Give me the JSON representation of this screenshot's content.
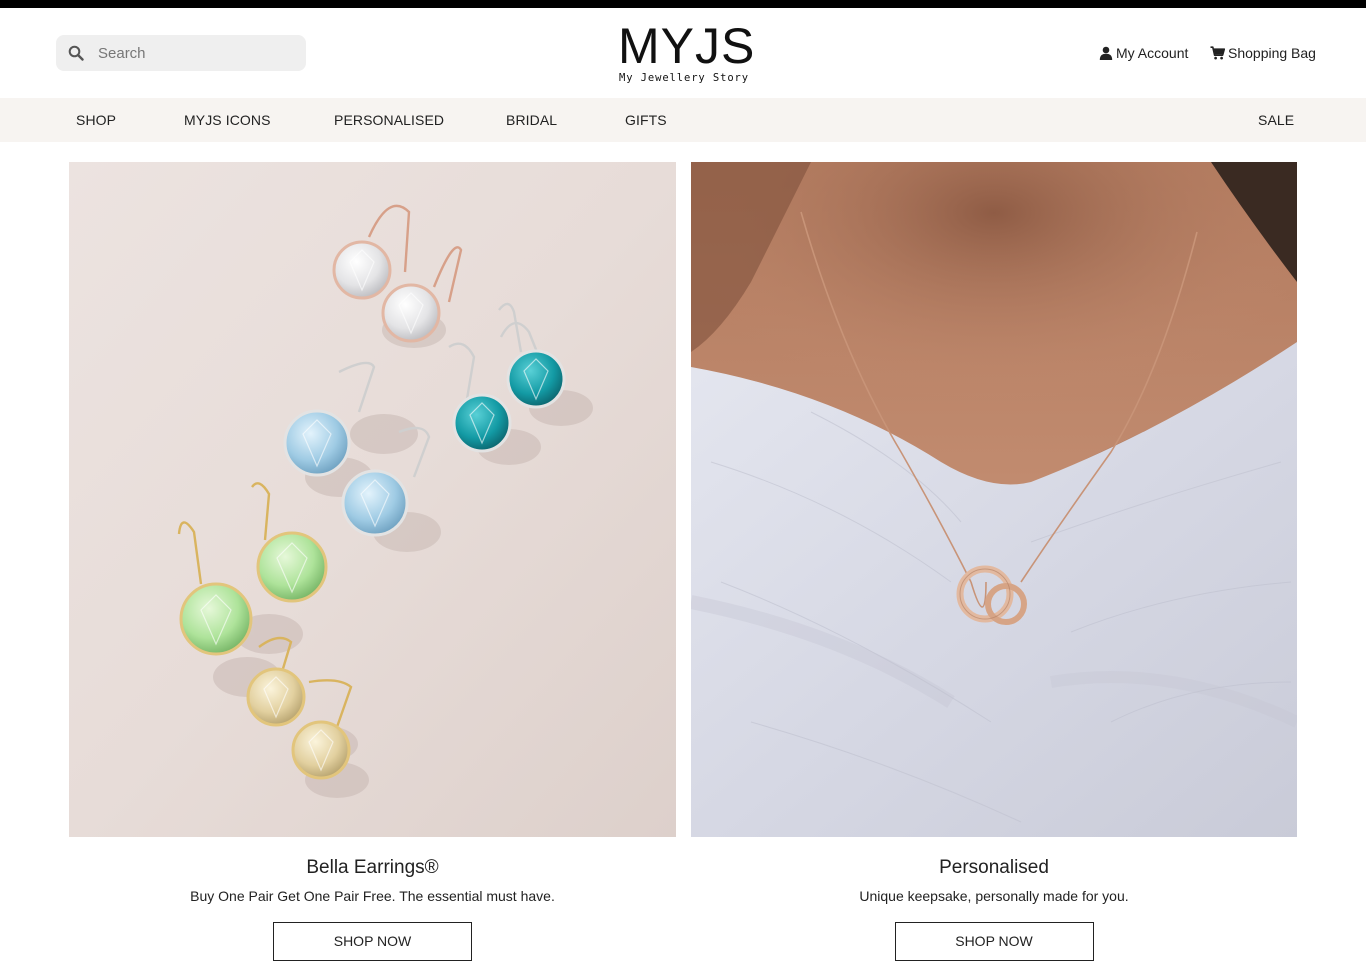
{
  "search": {
    "placeholder": "Search"
  },
  "logo": {
    "main": "MYJS",
    "tagline": "My Jewellery Story"
  },
  "header": {
    "account_label": "My Account",
    "bag_label": "Shopping Bag"
  },
  "nav": {
    "items": [
      {
        "label": "SHOP"
      },
      {
        "label": "MYJS ICONS"
      },
      {
        "label": "PERSONALISED"
      },
      {
        "label": "BRIDAL"
      },
      {
        "label": "GIFTS"
      }
    ],
    "sale_label": "SALE"
  },
  "cards": [
    {
      "title": "Bella Earrings®",
      "description": "Buy One Pair Get One Pair Free. The essential must have.",
      "button_label": "SHOP NOW"
    },
    {
      "title": "Personalised",
      "description": "Unique keepsake, personally made for you.",
      "button_label": "SHOP NOW"
    }
  ],
  "colors": {
    "nav_background": "#f7f4f1",
    "search_background": "#efefef",
    "top_strip": "#000000",
    "text": "#222222"
  },
  "icons": {
    "search": "search-icon",
    "account": "user-icon",
    "bag": "cart-icon"
  }
}
